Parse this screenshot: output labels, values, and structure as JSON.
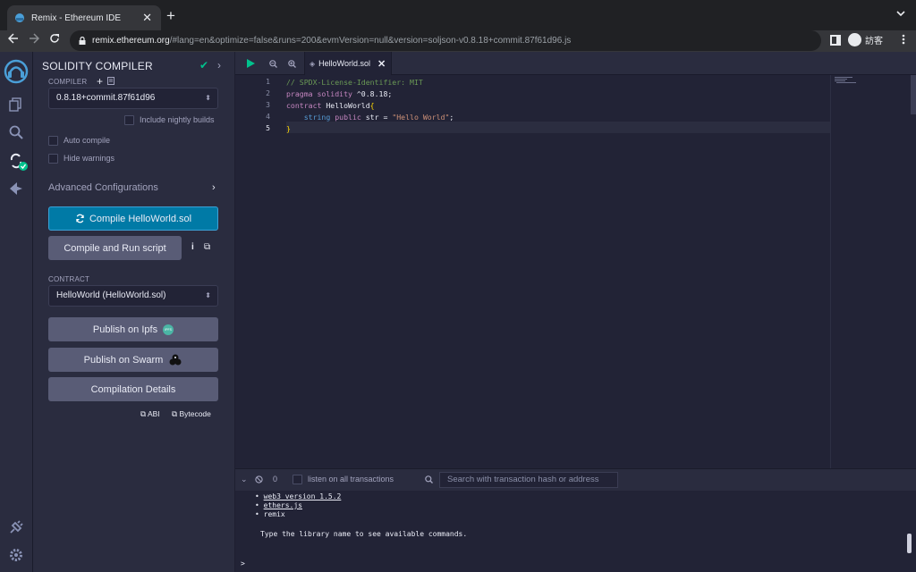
{
  "browser": {
    "tab_title": "Remix - Ethereum IDE",
    "tab_close": "✕",
    "new_tab": "+",
    "url_host": "remix.ethereum.org",
    "url_rest": "/#lang=en&optimize=false&runs=200&evmVersion=null&version=soljson-v0.8.18+commit.87f61d96.js",
    "profile_label": "訪客"
  },
  "sidepanel": {
    "title": "SOLIDITY COMPILER",
    "compiler_label": "COMPILER",
    "compiler_version": "0.8.18+commit.87f61d96",
    "nightly_label": "Include nightly builds",
    "auto_compile_label": "Auto compile",
    "hide_warnings_label": "Hide warnings",
    "advanced_label": "Advanced Configurations",
    "compile_button": "Compile HelloWorld.sol",
    "compile_run_button": "Compile and Run script",
    "contract_label": "CONTRACT",
    "contract_value": "HelloWorld (HelloWorld.sol)",
    "publish_ipfs": "Publish on Ipfs",
    "ipfs_badge": "IPFS",
    "publish_swarm": "Publish on Swarm",
    "compilation_details": "Compilation Details",
    "abi_link": "ABI",
    "bytecode_link": "Bytecode"
  },
  "editor": {
    "file_tab": "HelloWorld.sol",
    "line_numbers": [
      "1",
      "2",
      "3",
      "4",
      "5"
    ],
    "code": {
      "l1": "// SPDX-License-Identifier: MIT",
      "l2_kw": "pragma solidity",
      "l2_rest": " ^0.8.18;",
      "l3_kw": "contract",
      "l3_name": " HelloWorld",
      "l3_brace": "{",
      "l4_indent": "    ",
      "l4_type": "string",
      "l4_kw": " public",
      "l4_name": " str = ",
      "l4_str": "\"Hello World\"",
      "l4_end": ";",
      "l5": "}"
    }
  },
  "terminal": {
    "count": "0",
    "listen_label": "listen on all transactions",
    "search_placeholder": "Search with transaction hash or address",
    "lines": {
      "web3": "web3 version 1.5.2",
      "ethers": "ethers.js",
      "remix": "remix",
      "hint": "Type the library name to see available commands."
    },
    "prompt": ">"
  },
  "colors": {
    "primary": "#007aa6",
    "success": "#00c28d",
    "background": "#222336"
  }
}
